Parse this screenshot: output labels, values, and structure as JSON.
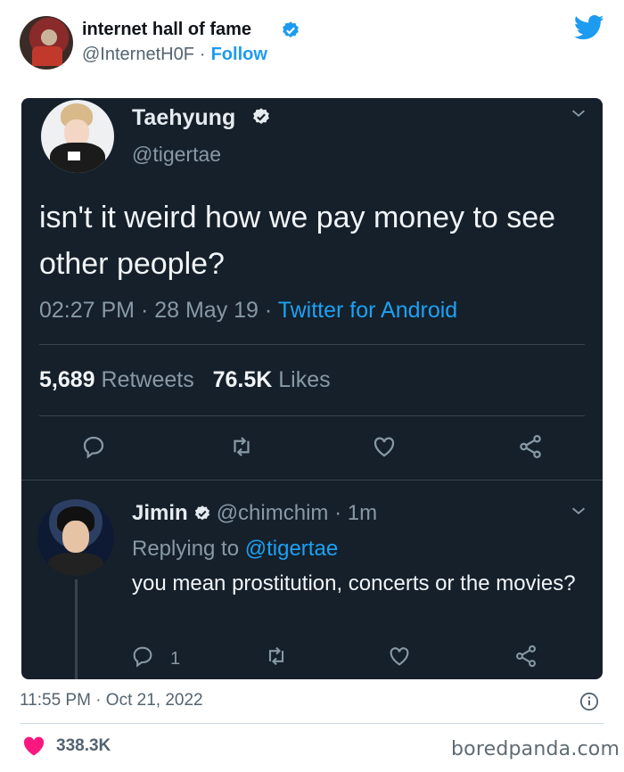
{
  "header": {
    "name": "internet hall of fame",
    "handle": "@InternetH0F",
    "separator": "·",
    "follow_label": "Follow",
    "avatar_icon": "user-avatar",
    "brand_icon": "twitter-bird-icon",
    "brand_color": "#1d9bf0"
  },
  "screenshot": {
    "background_color": "#15202b",
    "tweet": {
      "name": "Taehyung",
      "handle": "@tigertae",
      "text": "isn't it weird how we pay money to see other people?",
      "time": "02:27 PM · 28 May 19 · ",
      "source": "Twitter for Android",
      "retweets_count": "5,689",
      "retweets_label": " Retweets",
      "likes_count": "76.5K",
      "likes_label": " Likes"
    },
    "reply": {
      "name": "Jimin",
      "handle_time": "@chimchim · 1m",
      "replying_prefix": "Replying to ",
      "replying_handle": "@tigertae",
      "text": "you mean prostitution, concerts or the movies?",
      "reply_count": "1"
    }
  },
  "footer": {
    "timestamp": "11:55 PM · Oct 21, 2022",
    "likes": "338.3K",
    "like_color": "#f91880",
    "watermark": "boredpanda.com"
  }
}
